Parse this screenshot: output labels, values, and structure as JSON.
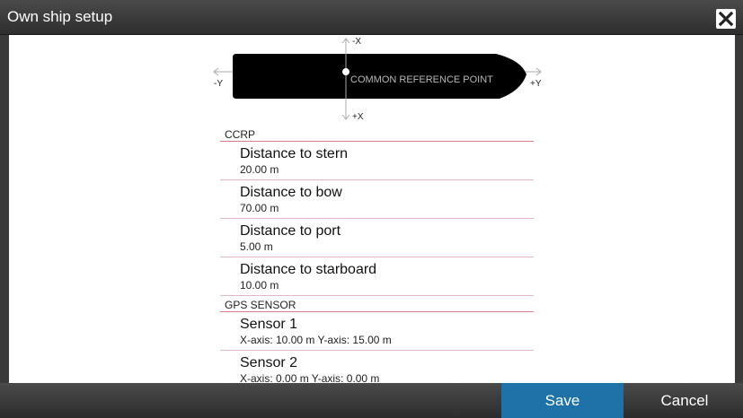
{
  "window": {
    "title": "Own ship setup"
  },
  "diagram": {
    "axis_neg_x": "-X",
    "axis_pos_x": "+X",
    "axis_neg_y": "-Y",
    "axis_pos_y": "+Y",
    "reference_label": "COMMON REFERENCE POINT"
  },
  "sections": [
    {
      "header": "CCRP",
      "items": [
        {
          "title": "Distance to stern",
          "value": "20.00 m"
        },
        {
          "title": "Distance to bow",
          "value": "70.00 m"
        },
        {
          "title": "Distance to port",
          "value": "5.00 m"
        },
        {
          "title": "Distance to starboard",
          "value": "10.00 m"
        }
      ]
    },
    {
      "header": "GPS SENSOR",
      "items": [
        {
          "title": "Sensor 1",
          "value": "X-axis: 10.00 m  Y-axis: 15.00 m"
        },
        {
          "title": "Sensor 2",
          "value": "X-axis: 0.00 m  Y-axis: 0.00 m"
        }
      ]
    }
  ],
  "buttons": {
    "save": "Save",
    "cancel": "Cancel"
  },
  "colors": {
    "save_accent": "#1e72a8",
    "divider": "#e07a8a"
  }
}
